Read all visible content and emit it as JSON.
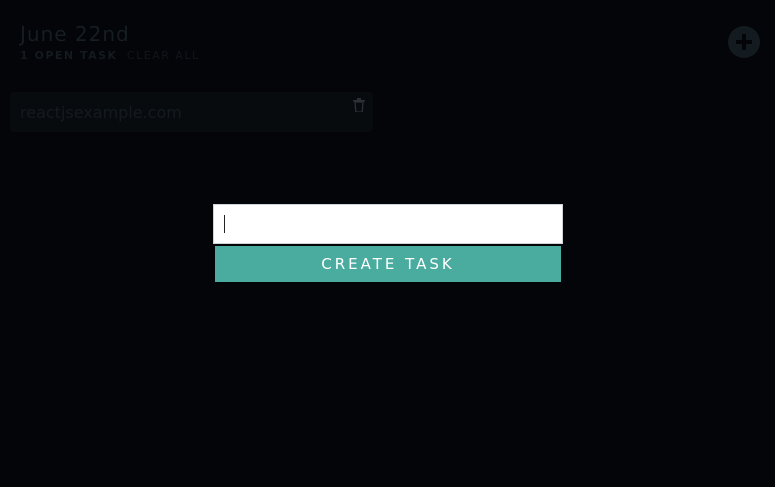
{
  "header": {
    "date": "June 22nd",
    "open_count": "1 OPEN TASK",
    "clear_all_label": "CLEAR ALL",
    "add_icon": "plus-circle-icon"
  },
  "tasks": [
    {
      "text": "reactjsexample.com",
      "delete_icon": "trash-icon"
    }
  ],
  "modal": {
    "input_value": "",
    "create_label": "CREATE TASK"
  },
  "colors": {
    "background": "#030508",
    "accent": "#4aab9f",
    "muted_text": "#141b20"
  }
}
